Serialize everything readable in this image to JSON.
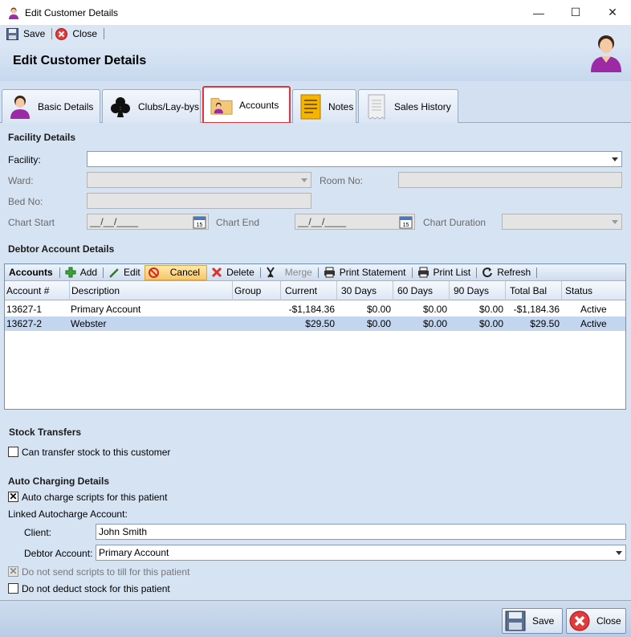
{
  "window": {
    "title": "Edit Customer Details",
    "controls": {
      "minimize": "—",
      "maximize": "☐",
      "close": "✕"
    }
  },
  "toolbar": {
    "save_label": "Save",
    "close_label": "Close"
  },
  "header": {
    "title": "Edit Customer Details"
  },
  "tabs": [
    {
      "label": "Basic Details",
      "icon": "person-icon"
    },
    {
      "label": "Clubs/Lay-bys",
      "icon": "club-icon"
    },
    {
      "label": "Accounts",
      "icon": "accounts-folder-icon",
      "active": true
    },
    {
      "label": "Notes",
      "icon": "notes-icon"
    },
    {
      "label": "Sales History",
      "icon": "receipt-icon"
    }
  ],
  "facility": {
    "section_title": "Facility Details",
    "facility_label": "Facility:",
    "facility_value": "",
    "ward_label": "Ward:",
    "room_label": "Room No:",
    "bed_label": "Bed No:",
    "chart_start_label": "Chart Start",
    "chart_start_value": "__/__/____",
    "chart_end_label": "Chart End",
    "chart_end_value": "__/__/____",
    "chart_duration_label": "Chart Duration"
  },
  "debtor": {
    "section_title": "Debtor Account Details",
    "grid_title": "Accounts",
    "buttons": {
      "add": "Add",
      "edit": "Edit",
      "cancel": "Cancel",
      "delete": "Delete",
      "merge": "Merge",
      "print_statement": "Print Statement",
      "print_list": "Print List",
      "refresh": "Refresh"
    },
    "columns": [
      "Account #",
      "Description",
      "Group",
      "Current",
      "30 Days",
      "60 Days",
      "90 Days",
      "Total Bal",
      "Status"
    ],
    "rows": [
      {
        "account": "13627-1",
        "description": "Primary Account",
        "group": "",
        "current": "-$1,184.36",
        "d30": "$0.00",
        "d60": "$0.00",
        "d90": "$0.00",
        "total": "-$1,184.36",
        "status": "Active",
        "selected": false
      },
      {
        "account": "13627-2",
        "description": "Webster",
        "group": "",
        "current": "$29.50",
        "d30": "$0.00",
        "d60": "$0.00",
        "d90": "$0.00",
        "total": "$29.50",
        "status": "Active",
        "selected": true
      }
    ]
  },
  "stock": {
    "section_title": "Stock Transfers",
    "can_transfer_label": "Can transfer stock to this customer",
    "can_transfer_checked": false
  },
  "autocharge": {
    "section_title": "Auto Charging Details",
    "auto_charge_label": "Auto charge scripts for this patient",
    "auto_charge_checked": true,
    "linked_label": "Linked Autocharge Account:",
    "client_label": "Client:",
    "client_value": "John Smith",
    "debtor_label": "Debtor Account:",
    "debtor_value": "Primary Account",
    "no_send_label": "Do not send scripts to till for this patient",
    "no_send_checked": true,
    "no_deduct_label": "Do not deduct stock for this patient",
    "no_deduct_checked": false
  },
  "footer": {
    "save_label": "Save",
    "close_label": "Close"
  },
  "colors": {
    "background": "#d6e3f3",
    "active_tab_border": "#e0353b",
    "selected_row": "#c4d6ef",
    "cancel_highlight": "#f7c76a"
  }
}
